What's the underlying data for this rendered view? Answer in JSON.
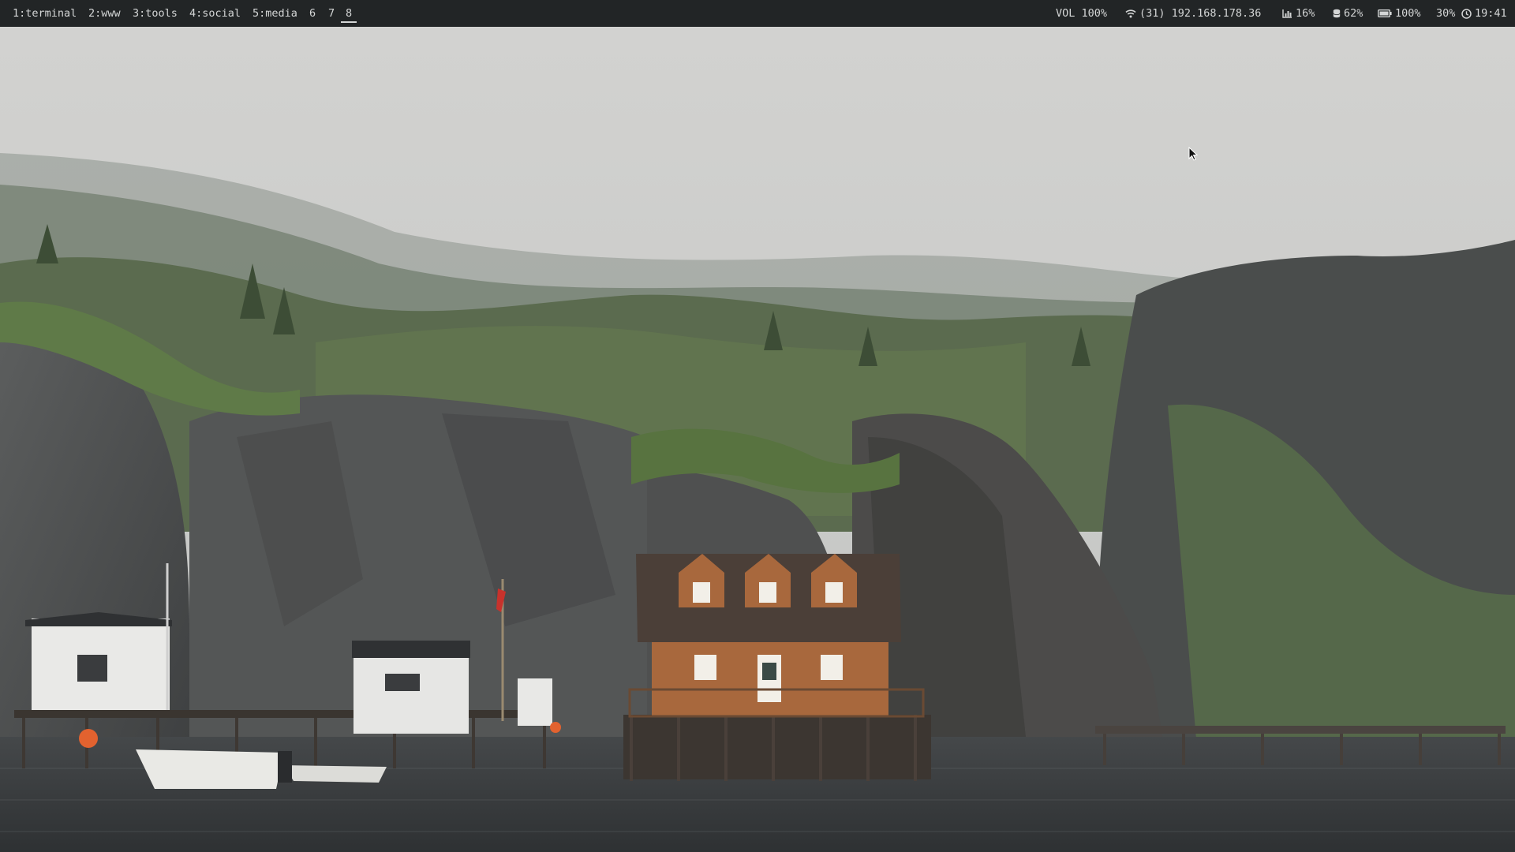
{
  "workspaces": [
    {
      "label": "1:terminal",
      "active": false
    },
    {
      "label": "2:www",
      "active": false
    },
    {
      "label": "3:tools",
      "active": false
    },
    {
      "label": "4:social",
      "active": false
    },
    {
      "label": "5:media",
      "active": false
    },
    {
      "label": "6",
      "active": false
    },
    {
      "label": "7",
      "active": false
    },
    {
      "label": "8",
      "active": true
    }
  ],
  "status": {
    "volume": "VOL 100%",
    "wifi": "(31) 192.168.178.36",
    "cpu": "16%",
    "memory": "62%",
    "battery": "100%",
    "brightness": "30%",
    "clock": "19:41"
  },
  "colors": {
    "bar_bg": "#222526",
    "bar_fg": "#d4d6d6"
  },
  "icons": {
    "wifi": "wifi-icon",
    "cpu": "chart-icon",
    "memory": "disk-icon",
    "battery": "battery-icon",
    "clock": "clock-icon"
  }
}
